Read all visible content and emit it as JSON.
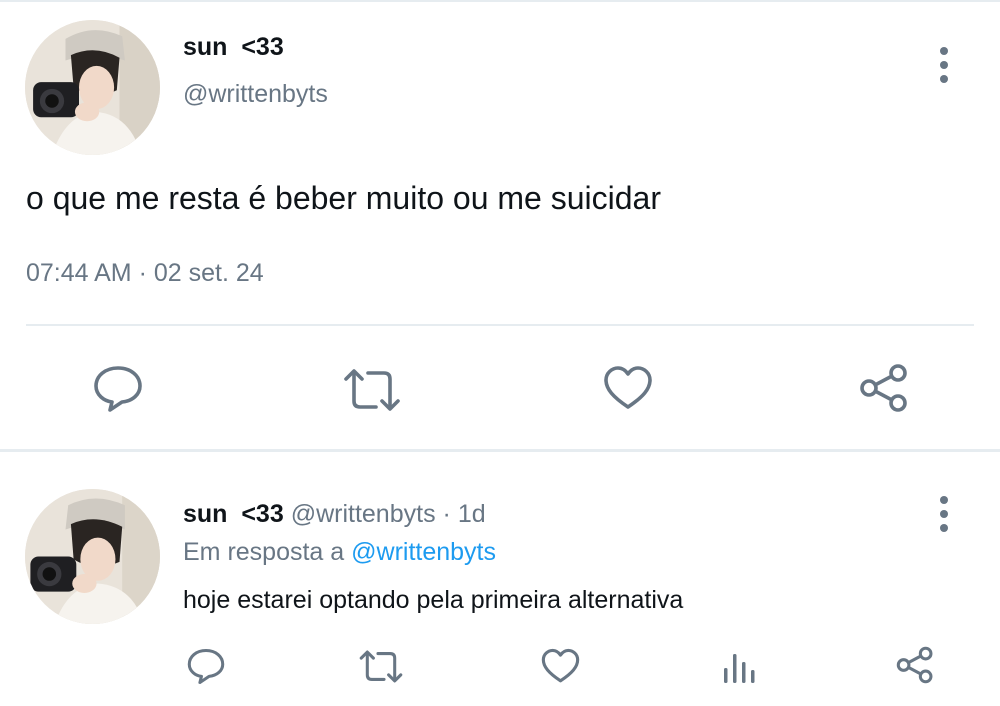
{
  "main_tweet": {
    "author_name": "sun  <33",
    "author_handle": "@writtenbyts",
    "text": "o que me resta é beber muito ou me suicidar",
    "time": "07:44 AM",
    "date": "02 set. 24",
    "separator": "·"
  },
  "reply_tweet": {
    "author_name": "sun  <33",
    "author_handle": "@writtenbyts",
    "separator": "·",
    "age": "1d",
    "reply_prefix": "Em resposta a",
    "reply_to": "@writtenbyts",
    "text": "hoje estarei optando pela primeira alternativa"
  },
  "icons": {
    "reply": "comment-bubble-icon",
    "retweet": "retweet-icon",
    "like": "heart-icon",
    "share": "share-icon",
    "analytics": "bar-chart-icon",
    "more": "vertical-dots-icon"
  },
  "colors": {
    "text": "#0f1419",
    "secondary": "#687684",
    "link": "#1d9bf0",
    "divider": "#e6ecf0"
  }
}
